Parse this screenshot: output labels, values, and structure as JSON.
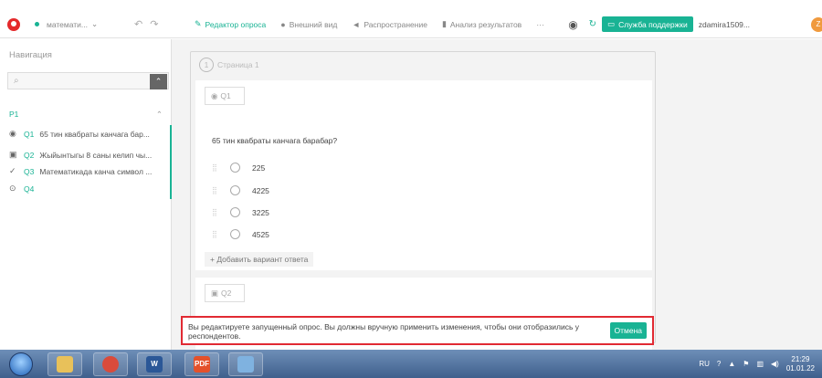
{
  "topbar": {
    "survey_name": "математи...",
    "tabs": [
      {
        "icon": "edit-icon",
        "label": "Редактор опроса",
        "active": true
      },
      {
        "icon": "palette-icon",
        "label": "Внешний вид",
        "active": false
      },
      {
        "icon": "send-icon",
        "label": "Распространение",
        "active": false
      },
      {
        "icon": "bar-chart-icon",
        "label": "Анализ результатов",
        "active": false
      }
    ],
    "more": "···",
    "support_label": "Служба поддержки",
    "username": "zdamira1509...",
    "avatar_letter": "Z"
  },
  "sidebar": {
    "title": "Навигация",
    "search_placeholder": "",
    "page_label": "P1",
    "questions": [
      {
        "num": "Q1",
        "text": "65 тин квабраты канчага бар...",
        "icon": "radio-icon"
      },
      {
        "num": "Q2",
        "text": "Жыйынтыгы 8 саны келип чы...",
        "icon": "image-choice-icon"
      },
      {
        "num": "Q3",
        "text": "Математикада канча символ ...",
        "icon": "check-icon"
      },
      {
        "num": "Q4",
        "text": "",
        "icon": "radio-icon"
      }
    ]
  },
  "main": {
    "page_number": "1",
    "page_label": "Страница 1",
    "q1": {
      "tag": "Q1",
      "text": "65 тин квабраты канчага барабар?",
      "options": [
        "225",
        "4225",
        "3225",
        "4525"
      ],
      "add_answer": "+ Добавить вариант ответа"
    },
    "q2": {
      "tag": "Q2"
    },
    "warning": {
      "message": "Вы редактируете запущенный опрос. Вы должны вручную применить изменения, чтобы они отобразились у респондентов.",
      "cancel_label": "Отмена"
    }
  },
  "taskbar": {
    "lang": "RU",
    "time": "21:29",
    "date": "01.01.22"
  },
  "colors": {
    "accent": "#19b394",
    "warning_border": "#e12a33"
  }
}
